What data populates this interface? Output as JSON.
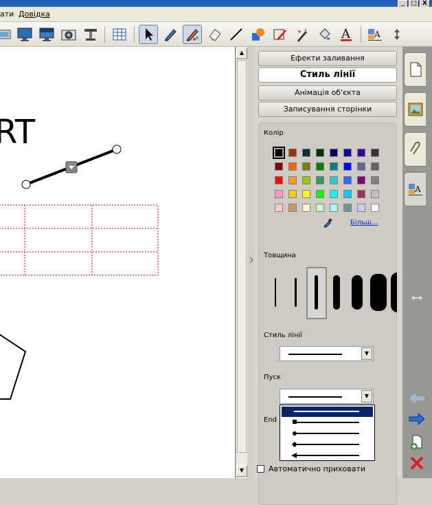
{
  "menu": {
    "item1": "ати",
    "item2": "Довідка"
  },
  "window_buttons": {
    "minimize": "_",
    "maximize": "□",
    "close": "X"
  },
  "canvas": {
    "text": "RT"
  },
  "panel": {
    "tabs": [
      {
        "label": "Ефекти заливання"
      },
      {
        "label": "Стиль лінії"
      },
      {
        "label": "Анімація об'єкта"
      },
      {
        "label": "Записування сторінки"
      }
    ],
    "color_label": "Колір",
    "more_link": "Більш...",
    "thickness_label": "Товщина",
    "line_style_label": "Стиль лінії",
    "start_label": "Пуск",
    "end_label": "End",
    "autohide_label": "Автоматично приховати"
  },
  "colors": {
    "palette": [
      [
        "#000000",
        "#993300",
        "#003333",
        "#003300",
        "#000066",
        "#000099",
        "#330099",
        "#333333"
      ],
      [
        "#800000",
        "#ff6600",
        "#808000",
        "#008000",
        "#008080",
        "#0000ff",
        "#666699",
        "#666666"
      ],
      [
        "#ff0000",
        "#ff9933",
        "#99cc00",
        "#339966",
        "#33cccc",
        "#3366ff",
        "#800080",
        "#808080"
      ],
      [
        "#ff99cc",
        "#ffcc00",
        "#ffff00",
        "#00ff00",
        "#00ffff",
        "#00ccff",
        "#993366",
        "#c0c0c0"
      ],
      [
        "#ffcccc",
        "#cc9966",
        "#ffffcc",
        "#ccffcc",
        "#99ffff",
        "#669999",
        "#ccccff",
        "#ffffff"
      ]
    ],
    "selected": "#000000",
    "accent": "#0a246a",
    "panel_bg": "#d9d6cf"
  },
  "toolbar_icons": [
    "document-camera-icon",
    "monitor-icon",
    "screen-shade-icon",
    "camera-icon",
    "document-camera-arm-icon",
    "table-icon",
    "select-arrow-icon",
    "pen-icon",
    "creative-pen-icon",
    "eraser-icon",
    "line-icon",
    "shapes-icon",
    "magic-pen-icon",
    "shape-pen-icon",
    "fill-icon",
    "text-icon",
    "properties-icon",
    "move-toolbar-icon"
  ],
  "side_icons": [
    "page-sorter-icon",
    "gallery-icon",
    "attachments-icon",
    "properties-icon",
    "resize-icon",
    "back-arrow-icon",
    "forward-arrow-icon",
    "add-page-icon",
    "delete-icon"
  ]
}
